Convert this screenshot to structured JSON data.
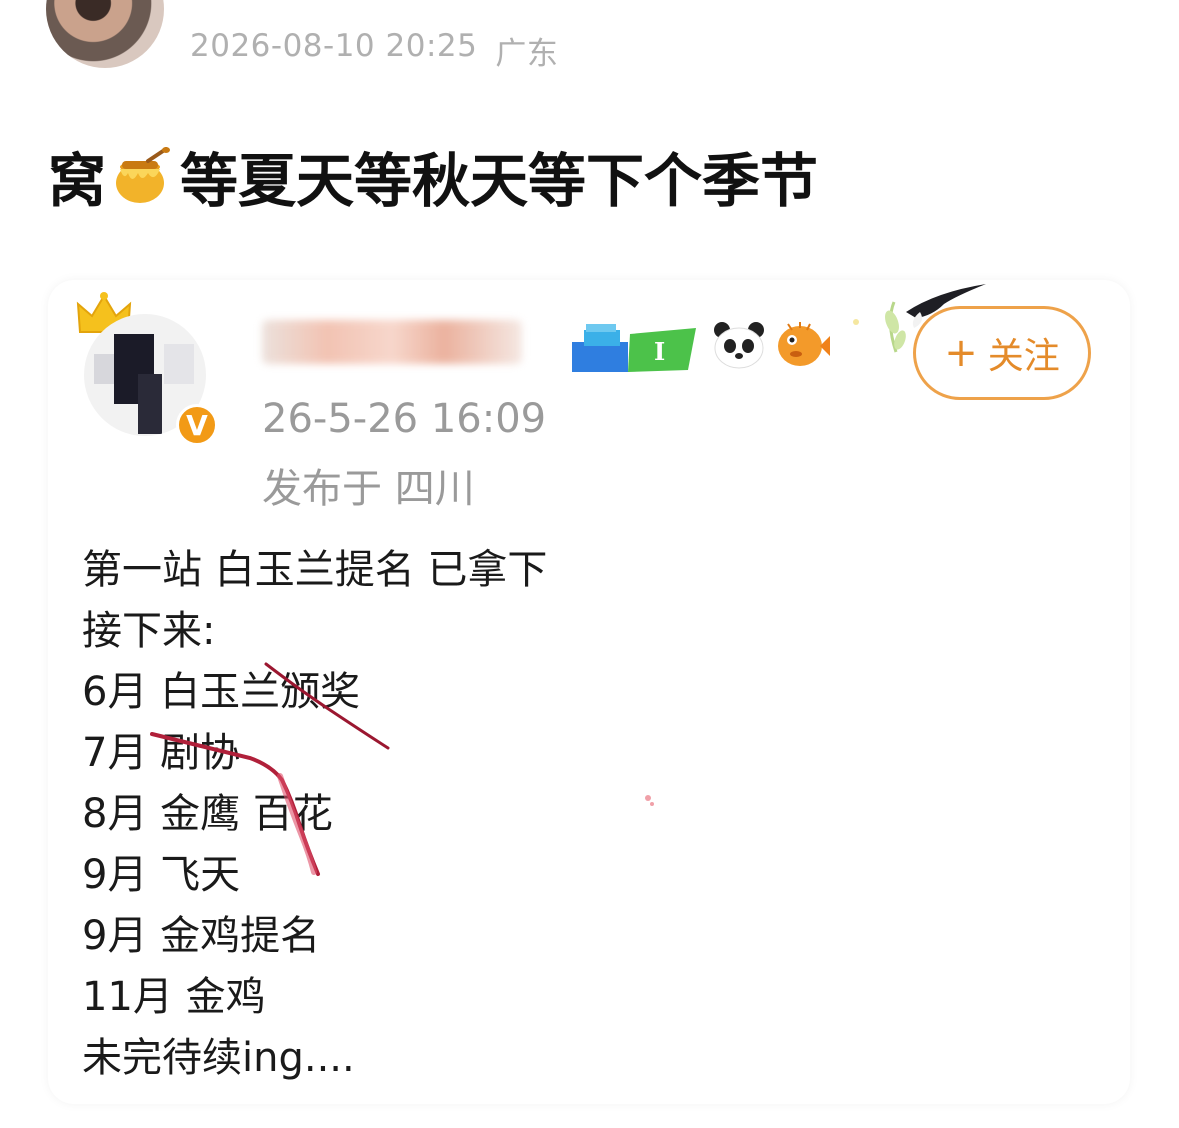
{
  "post": {
    "avatar_icon": "user-avatar",
    "timestamp": "2026-08-10 20:25",
    "location": "广东",
    "text_before": "窝",
    "emoji": "honey-pot-icon",
    "text_after": "等夏天等秋天等下个季节"
  },
  "quoted": {
    "avatar_icon": "user-avatar",
    "crown_icon": "crown-icon",
    "verified_badge": "V",
    "badges": [
      "level-badge-icon",
      "panda-icon",
      "pufferfish-icon",
      "swallow-decoration-icon"
    ],
    "follow_plus": "+",
    "follow_label": "关注",
    "time": "26-5-26 16:09",
    "location": "发布于 四川",
    "lines": [
      "第一站 白玉兰提名 已拿下",
      "接下来:",
      "6月 白玉兰颁奖",
      "7月 剧协",
      "8月 金鹰 百花",
      "9月 飞天",
      "9月 金鸡提名",
      "11月 金鸡",
      "未完待续ing...."
    ]
  },
  "colors": {
    "accent": "#eea24a",
    "meta_text": "#b0b0b0",
    "scribble": "#9b1730"
  }
}
